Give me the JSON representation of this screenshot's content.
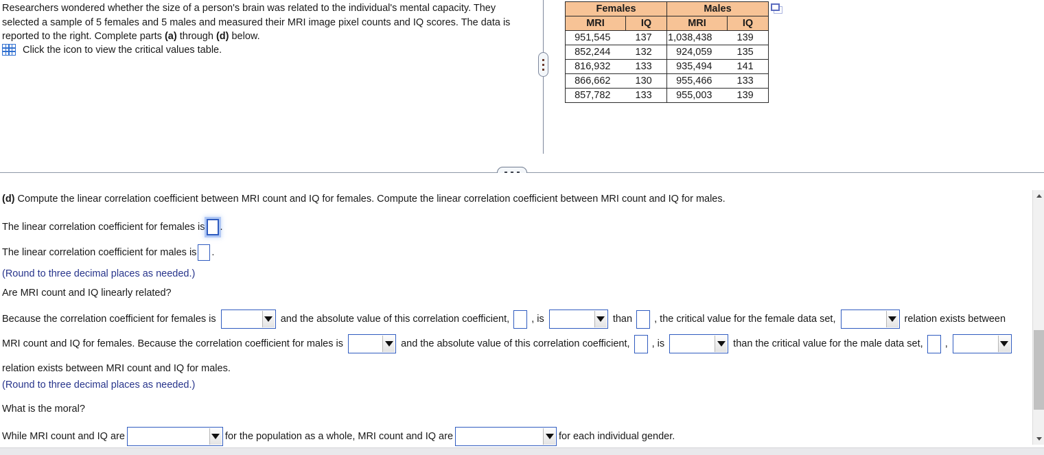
{
  "prompt": {
    "line1": "Researchers wondered whether the size of a person's brain was related to the individual's mental",
    "line2": "capacity. They selected a sample of 5 females and 5 males and measured their MRI image pixel counts",
    "line3_a": "and IQ scores. The data is reported to the right. Complete parts ",
    "line3_bold_a": "(a)",
    "line3_b": " through ",
    "line3_bold_b": "(d)",
    "line3_c": " below.",
    "icon_link_text": "Click the icon to view the critical values table.",
    "icon_name": "table-grid-icon"
  },
  "data_table": {
    "group_headers": [
      "Females",
      "Males"
    ],
    "sub_headers": [
      "MRI",
      "IQ",
      "MRI",
      "IQ"
    ],
    "rows": [
      [
        "951,545",
        "137",
        "1,038,438",
        "139"
      ],
      [
        "852,244",
        "132",
        "924,059",
        "135"
      ],
      [
        "816,932",
        "133",
        "935,494",
        "141"
      ],
      [
        "866,662",
        "130",
        "955,466",
        "133"
      ],
      [
        "857,782",
        "133",
        "955,003",
        "139"
      ]
    ],
    "header_bg": "#F7C396",
    "popout_icon": "popout-window-icon"
  },
  "question_d": {
    "intro": "(d)",
    "intro_rest": " Compute the linear correlation coefficient between MRI count and IQ for females. Compute the linear correlation coefficient between MRI count and IQ for males.",
    "females_label": "The linear correlation coefficient for females is",
    "females_period": ".",
    "males_label": "The linear correlation coefficient for males is",
    "males_period": ".",
    "round_note_1": "(Round to three decimal places as needed.)",
    "are_related": "Are MRI count and IQ linearly related?",
    "para": {
      "t1": "Because the correlation coefficient for females is",
      "t2": "and the absolute value of this correlation coefficient,",
      "t3": ", is",
      "t4": "than",
      "t5": ", the critical value for the female data set,",
      "t6": "relation",
      "t7": "exists between MRI count and IQ for females. Because the correlation coefficient for males is",
      "t8": "and the absolute value of this correlation coefficient,",
      "t9": ", is",
      "t10": "than the critical value for the",
      "t11": "male data set,",
      "t12": ",",
      "t13": "relation exists between MRI count and IQ for males."
    },
    "round_note_2": "(Round to three decimal places as needed.)",
    "moral_question": "What is the moral?",
    "moral": {
      "m1": "While MRI count and IQ are",
      "m2": "for the population as a whole, MRI count and IQ are",
      "m3": "for each individual gender."
    }
  },
  "answer_values": {
    "females_coefficient": "",
    "males_coefficient": "",
    "abs_coefficient_female": "",
    "critical_value_female": "",
    "abs_coefficient_male": "",
    "critical_value_male": "",
    "dd_female_sign": "",
    "dd_female_compare": "",
    "dd_female_relation": "",
    "dd_male_sign": "",
    "dd_male_compare": "",
    "dd_male_relation": "",
    "dd_moral_population": "",
    "dd_moral_gender": ""
  },
  "colors": {
    "hint_text": "#27348B",
    "input_border": "#2F5BBF",
    "table_header": "#F7C396",
    "icon_blue": "#2F6FD0"
  }
}
